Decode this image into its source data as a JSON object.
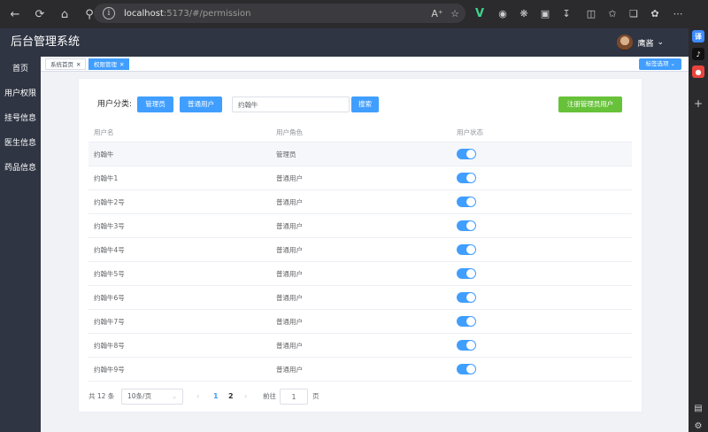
{
  "browser": {
    "url_host": "localhost",
    "url_path": ":5173/#/permission"
  },
  "app": {
    "title": "后台管理系统",
    "user_name": "鹰酱"
  },
  "leftnav": {
    "items": [
      "首页",
      "用户权限",
      "挂号信息",
      "医生信息",
      "药品信息"
    ]
  },
  "tabs": {
    "items": [
      {
        "label": "系统首页",
        "active": false
      },
      {
        "label": "权限管理",
        "active": true
      }
    ],
    "options_label": "标签选项"
  },
  "filter": {
    "label": "用户分类:",
    "admin_button": "管理员",
    "normal_button": "普通用户",
    "search_value": "约翰牛",
    "search_button": "搜索",
    "register_button": "注册管理员用户"
  },
  "table": {
    "headers": [
      "用户名",
      "用户角色",
      "用户状态"
    ],
    "rows": [
      {
        "name": "约翰牛",
        "role": "管理员",
        "enabled": true
      },
      {
        "name": "约翰牛1",
        "role": "普通用户",
        "enabled": true
      },
      {
        "name": "约翰牛2号",
        "role": "普通用户",
        "enabled": true
      },
      {
        "name": "约翰牛3号",
        "role": "普通用户",
        "enabled": true
      },
      {
        "name": "约翰牛4号",
        "role": "普通用户",
        "enabled": true
      },
      {
        "name": "约翰牛5号",
        "role": "普通用户",
        "enabled": true
      },
      {
        "name": "约翰牛6号",
        "role": "普通用户",
        "enabled": true
      },
      {
        "name": "约翰牛7号",
        "role": "普通用户",
        "enabled": true
      },
      {
        "name": "约翰牛8号",
        "role": "普通用户",
        "enabled": true
      },
      {
        "name": "约翰牛9号",
        "role": "普通用户",
        "enabled": true
      }
    ]
  },
  "pagination": {
    "total": "共 12 条",
    "page_size": "10条/页",
    "pages": [
      "1",
      "2"
    ],
    "current_page": "1",
    "goto_label": "前往",
    "goto_value": "1",
    "page_suffix": "页"
  },
  "colors": {
    "primary": "#409eff",
    "success": "#67c23a",
    "header_bg": "#2f3543"
  }
}
